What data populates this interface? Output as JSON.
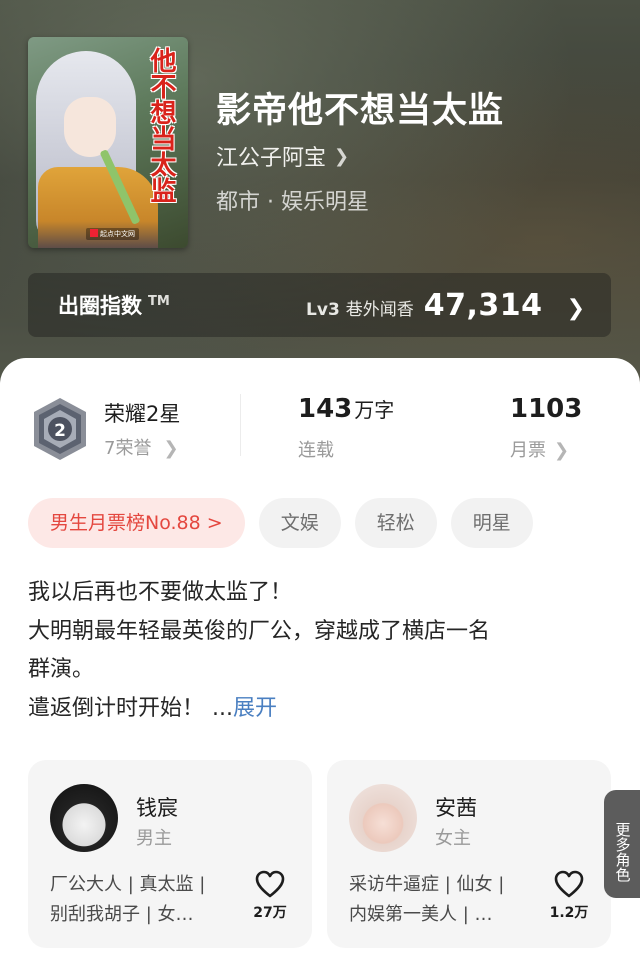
{
  "book": {
    "title": "影帝他不想当太监",
    "author": "江公子阿宝",
    "genre": "都市 · 娱乐明星",
    "cover_title": "他不想当太监"
  },
  "index": {
    "label": "出圈指数",
    "tm": "TM",
    "level": "Lv3",
    "rank_name": "巷外闻香",
    "value": "47,314"
  },
  "stats": {
    "honor_title": "荣耀2星",
    "honor_sub": "7荣誉",
    "words_num": "143",
    "words_unit": "万字",
    "words_status": "连载",
    "tickets_num": "1103",
    "tickets_label": "月票"
  },
  "tags": [
    "男生月票榜No.88 >",
    "文娱",
    "轻松",
    "明星"
  ],
  "synopsis": {
    "lines": [
      "我以后再也不要做太监了！",
      "大明朝最年轻最英俊的厂公，穿越成了横店一名",
      "群演。",
      "遣返倒计时开始！"
    ],
    "ellipsis": "...",
    "expand": "展开"
  },
  "characters": [
    {
      "name": "钱宸",
      "role": "男主",
      "desc_lines": [
        "厂公大人 | 真太监 |",
        "别刮我胡子 | 女…"
      ],
      "likes": "27万"
    },
    {
      "name": "安茜",
      "role": "女主",
      "desc_lines": [
        "采访牛逼症 | 仙女 |",
        "内娱第一美人 | …"
      ],
      "likes": "1.2万"
    }
  ],
  "side_tab": "更多角色",
  "colors": {
    "accent_red": "#e4473f",
    "link_blue": "#4a7fc1",
    "hero_bg": "#4a4f43"
  },
  "icons": {
    "chevron": "chevron-right-icon",
    "heart": "heart-icon",
    "badge": "honor-badge-icon"
  }
}
